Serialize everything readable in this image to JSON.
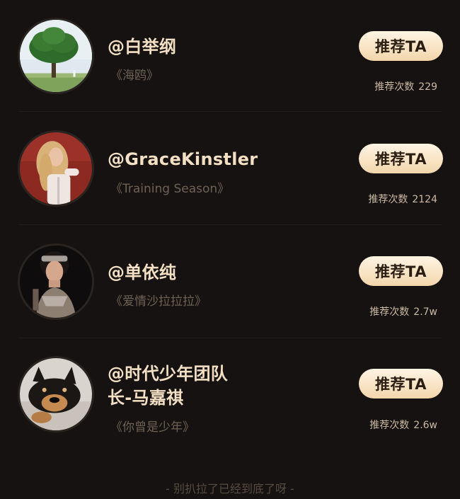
{
  "recommend_list": [
    {
      "name": "@白举纲",
      "song": "《海鸥》",
      "button_label": "推荐TA",
      "count_label": "推荐次数",
      "count_value": "229",
      "avatar_icon": "tree-in-field-avatar"
    },
    {
      "name": "@GraceKinstler",
      "song": "《Training Season》",
      "button_label": "推荐TA",
      "count_label": "推荐次数",
      "count_value": "2124",
      "avatar_icon": "woman-blonde-hair-avatar"
    },
    {
      "name": "@单依纯",
      "song": "《爱情沙拉拉拉》",
      "button_label": "推荐TA",
      "count_label": "推荐次数",
      "count_value": "2.7w",
      "avatar_icon": "woman-dark-portrait-avatar"
    },
    {
      "name_line1": "@时代少年团队",
      "name_line2": "长-马嘉祺",
      "song": "《你曾是少年》",
      "button_label": "推荐TA",
      "count_label": "推荐次数",
      "count_value": "2.6w",
      "avatar_icon": "shiba-dog-avatar"
    }
  ],
  "footer_text": "- 别扒拉了已经到底了呀 -",
  "colors": {
    "background": "#151211",
    "name_text": "#f3dfc3",
    "song_text": "#6e6254",
    "button_gradient_top": "#fff4e3",
    "button_gradient_bottom": "#f2d6ac"
  }
}
